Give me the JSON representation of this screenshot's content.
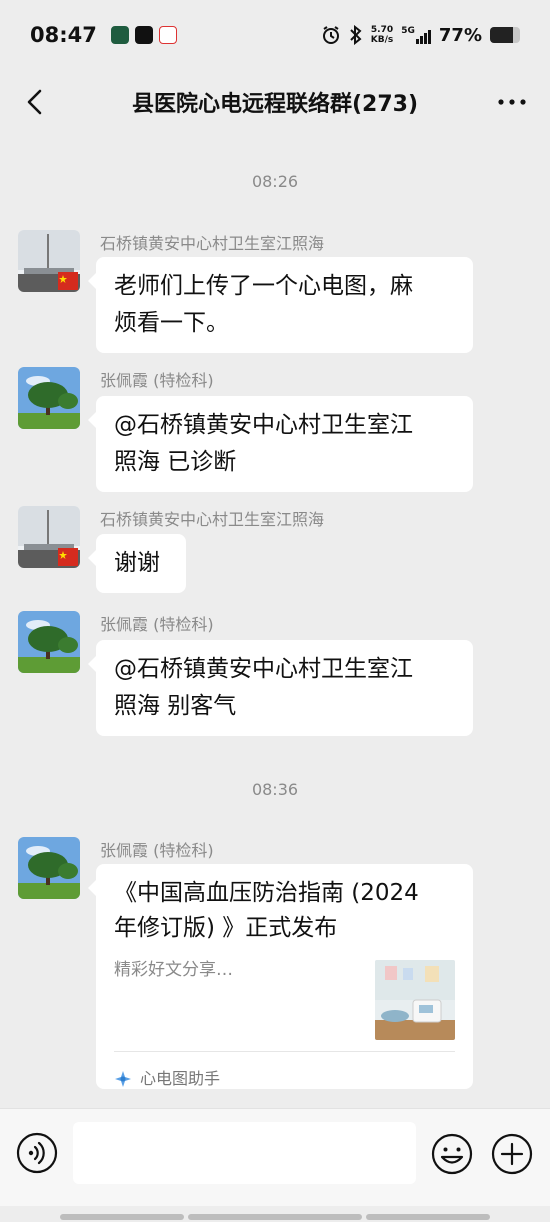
{
  "status": {
    "time": "08:47",
    "net_speed_value": "5.70",
    "net_speed_unit": "KB/s",
    "network": "5G",
    "battery_pct": "77%",
    "battery_level": 0.77
  },
  "header": {
    "title": "县医院心电远程联络群(273)",
    "back_icon": "chevron-left-icon",
    "more_icon": "more-dots-icon"
  },
  "chat": {
    "time_dividers": [
      "08:26",
      "08:36"
    ],
    "messages": [
      {
        "sender": "石桥镇黄安中心村卫生室江照海",
        "line1": "老师们上传了一个心电图，麻",
        "line2": "烦看一下。"
      },
      {
        "sender": "张佩霞 (特检科)",
        "line1": "@石桥镇黄安中心村卫生室江",
        "line2": "照海  已诊断"
      },
      {
        "sender": "石桥镇黄安中心村卫生室江照海",
        "line1": "谢谢"
      },
      {
        "sender": "张佩霞 (特检科)",
        "line1": "@石桥镇黄安中心村卫生室江",
        "line2": "照海  别客气"
      }
    ],
    "card": {
      "sender": "张佩霞 (特检科)",
      "title_line1": "《中国高血压防治指南 (2024",
      "title_line2": "年修订版) 》正式发布",
      "desc": "精彩好文分享…",
      "source": "心电图助手"
    }
  },
  "input": {
    "placeholder": "",
    "voice_icon": "voice-icon",
    "emoji_icon": "emoji-icon",
    "plus_icon": "plus-icon"
  },
  "colors": {
    "background": "#ededed",
    "bubble": "#ffffff",
    "meta_text": "#8a8a8a"
  }
}
